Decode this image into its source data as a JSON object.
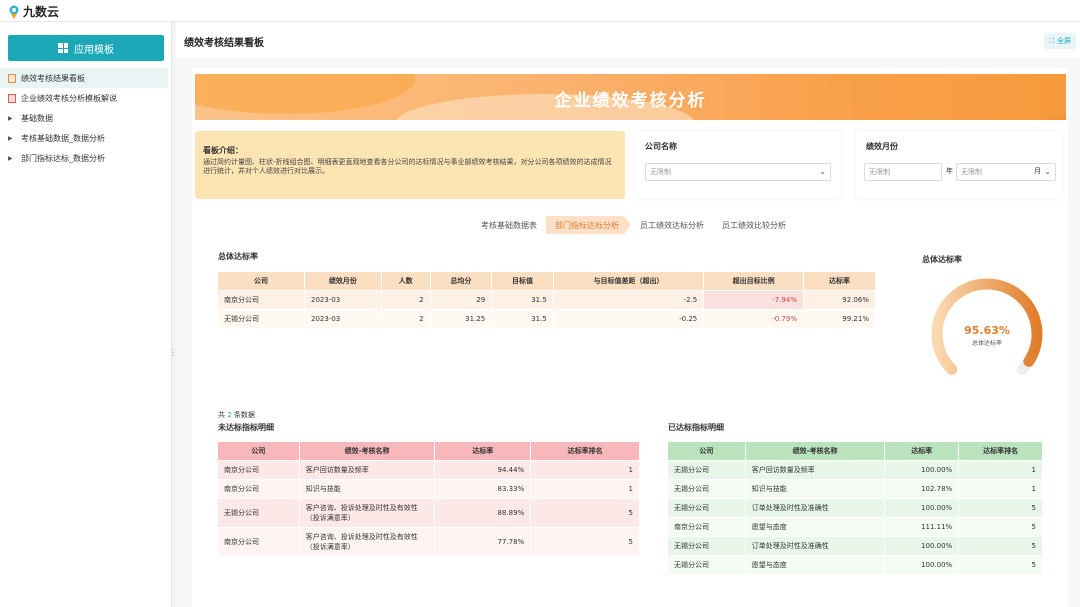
{
  "app": {
    "logo_text": "九数云"
  },
  "sidebar": {
    "app_button": "应用模板",
    "items": [
      {
        "label": "绩效考核结果看板",
        "type": "doc",
        "active": true
      },
      {
        "label": "企业绩效考核分析模板解说",
        "type": "doc-red"
      },
      {
        "label": "基础数据",
        "type": "folder"
      },
      {
        "label": "考核基础数据_数据分析",
        "type": "folder"
      },
      {
        "label": "部门指标达标_数据分析",
        "type": "folder"
      }
    ]
  },
  "header": {
    "title": "绩效考核结果看板",
    "fullscreen": "全屏"
  },
  "banner": {
    "title": "企业绩效考核分析"
  },
  "intro": {
    "title": "看板介绍：",
    "text": "通过简约计量图、柱状-折线组合图、明细表更直观地查看各分公司的达标情况与事业部绩效考核结果，对分公司各项绩效的达成情况进行统计，并对个人绩效进行对比展示。"
  },
  "filters": {
    "company": {
      "label": "公司名称",
      "placeholder": "无限制"
    },
    "month": {
      "label": "绩效月份",
      "year_placeholder": "无限制",
      "year_sep": "年",
      "month_placeholder": "无限制",
      "month_sep": "月"
    }
  },
  "tabs": [
    "考核基础数据表",
    "部门指标达标分析",
    "员工绩效达标分析",
    "员工绩效比较分析"
  ],
  "overall": {
    "title": "总体达标率",
    "headers": [
      "公司",
      "绩效月份",
      "人数",
      "总均分",
      "目标值",
      "与目标值差距（超出）",
      "超出目标比例",
      "达标率"
    ],
    "rows": [
      [
        "南京分公司",
        "2023-03",
        "2",
        "29",
        "31.5",
        "-2.5",
        "-7.94%",
        "92.06%"
      ],
      [
        "无锡分公司",
        "2023-03",
        "2",
        "31.25",
        "31.5",
        "-0.25",
        "-0.79%",
        "99.21%"
      ]
    ],
    "total_prefix": "共",
    "total_count": "2",
    "total_suffix": "条数据"
  },
  "gauge": {
    "title": "总体达标率",
    "value": "95.63%",
    "fraction": 0.9563,
    "label": "总体达标率",
    "color": "#e07d2b"
  },
  "unmet": {
    "title": "未达标指标明细",
    "headers": [
      "公司",
      "绩效-考核名称",
      "达标率",
      "达标率排名"
    ],
    "rows": [
      [
        "南京分公司",
        "客户回访数量及频率",
        "94.44%",
        "1"
      ],
      [
        "南京分公司",
        "知识与技能",
        "83.33%",
        "1"
      ],
      [
        "无锡分公司",
        "客户咨询、投诉处理及时性及有效性（投诉满意率）",
        "88.89%",
        "5"
      ],
      [
        "南京分公司",
        "客户咨询、投诉处理及时性及有效性（投诉满意率）",
        "77.78%",
        "5"
      ]
    ]
  },
  "met": {
    "title": "已达标指标明细",
    "headers": [
      "公司",
      "绩效-考核名称",
      "达标率",
      "达标率排名"
    ],
    "rows": [
      [
        "无锡分公司",
        "客户回访数量及频率",
        "100.00%",
        "1"
      ],
      [
        "无锡分公司",
        "知识与技能",
        "102.78%",
        "1"
      ],
      [
        "无锡分公司",
        "订单处理及时性及准确性",
        "100.00%",
        "5"
      ],
      [
        "南京分公司",
        "愿望与态度",
        "111.11%",
        "5"
      ],
      [
        "无锡分公司",
        "订单处理及时性及准确性",
        "100.00%",
        "5"
      ],
      [
        "无锡分公司",
        "愿望与态度",
        "100.00%",
        "5"
      ]
    ]
  }
}
